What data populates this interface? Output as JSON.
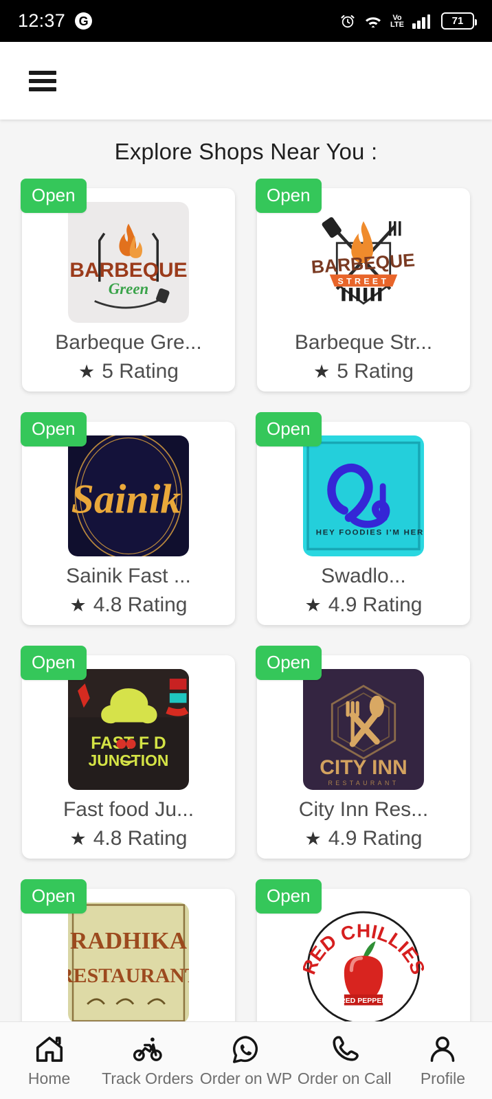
{
  "statusbar": {
    "time": "12:37",
    "app_icon_letter": "G",
    "battery_level": "71",
    "volte_top": "Vo",
    "volte_bottom": "LTE",
    "icons": [
      "alarm-icon",
      "wifi-icon",
      "volte-icon",
      "signal-icon",
      "battery-icon"
    ]
  },
  "appbar": {
    "menu_label": "Menu"
  },
  "main": {
    "title": "Explore Shops Near You :",
    "shops": [
      {
        "name": "Barbeque Gre...",
        "rating": "5 Rating",
        "status": "Open",
        "logo": "barbeque-green-logo"
      },
      {
        "name": "Barbeque Str...",
        "rating": "5 Rating",
        "status": "Open",
        "logo": "barbeque-street-logo"
      },
      {
        "name": "Sainik Fast ...",
        "rating": "4.8 Rating",
        "status": "Open",
        "logo": "sainik-logo"
      },
      {
        "name": "Swadlo...",
        "rating": "4.9 Rating",
        "status": "Open",
        "logo": "swadlo-logo"
      },
      {
        "name": "Fast food Ju...",
        "rating": "4.8 Rating",
        "status": "Open",
        "logo": "fast-food-junction-logo"
      },
      {
        "name": "City Inn Res...",
        "rating": "4.9 Rating",
        "status": "Open",
        "logo": "city-inn-logo"
      },
      {
        "name": "",
        "rating": "",
        "status": "Open",
        "logo": "radhika-restaurant-logo"
      },
      {
        "name": "",
        "rating": "",
        "status": "Open",
        "logo": "red-chillies-logo"
      }
    ]
  },
  "bottomnav": {
    "items": [
      {
        "label": "Home",
        "icon": "home-icon"
      },
      {
        "label": "Track Orders",
        "icon": "bicycle-icon"
      },
      {
        "label": "Order on WP",
        "icon": "whatsapp-icon"
      },
      {
        "label": "Order on Call",
        "icon": "phone-icon"
      },
      {
        "label": "Profile",
        "icon": "person-icon"
      }
    ]
  },
  "colors": {
    "badge_green": "#35c75a",
    "statusbar_bg": "#000000",
    "page_bg": "#f5f5f5",
    "card_bg": "#ffffff",
    "text_primary": "#1f1f1f",
    "text_secondary": "#4d4d4d",
    "nav_label": "#6e6e6e"
  }
}
